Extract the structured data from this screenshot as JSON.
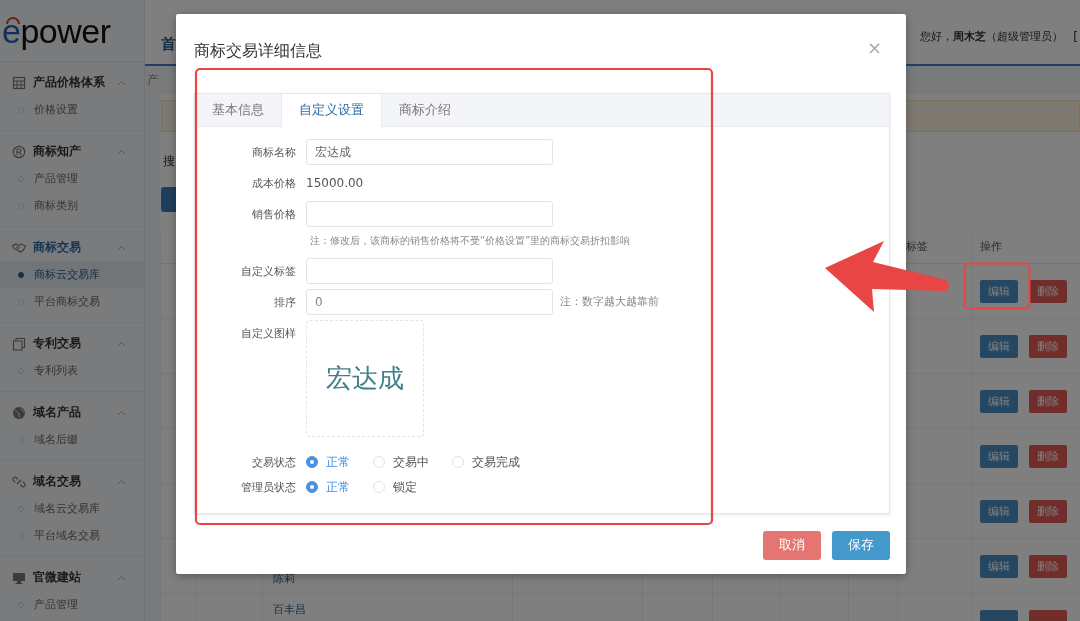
{
  "sidebar": {
    "logo": "epower",
    "groups": [
      {
        "title": "产品价格体系",
        "expanded": true,
        "selected": false,
        "items": [
          {
            "label": "价格设置",
            "selected": false
          }
        ]
      },
      {
        "title": "商标知产",
        "expanded": true,
        "selected": false,
        "items": [
          {
            "label": "产品管理",
            "selected": false
          },
          {
            "label": "商标类别",
            "selected": false
          }
        ]
      },
      {
        "title": "商标交易",
        "expanded": true,
        "selected": true,
        "items": [
          {
            "label": "商标云交易库",
            "selected": true
          },
          {
            "label": "平台商标交易",
            "selected": false
          }
        ]
      },
      {
        "title": "专利交易",
        "expanded": true,
        "selected": false,
        "items": [
          {
            "label": "专利列表",
            "selected": false
          }
        ]
      },
      {
        "title": "域名产品",
        "expanded": true,
        "selected": false,
        "items": [
          {
            "label": "域名后缀",
            "selected": false
          }
        ]
      },
      {
        "title": "域名交易",
        "expanded": true,
        "selected": false,
        "items": [
          {
            "label": "域名云交易库",
            "selected": false
          },
          {
            "label": "平台域名交易",
            "selected": false
          }
        ]
      },
      {
        "title": "官微建站",
        "expanded": true,
        "selected": false,
        "items": [
          {
            "label": "产品管理",
            "selected": false
          }
        ]
      }
    ]
  },
  "header": {
    "tab": "首",
    "greeting": "您好，**周木芝**（超级管理员）",
    "bracket": "["
  },
  "content": {
    "breadcrumb": "产",
    "search_label": "搜",
    "table": {
      "columns": {
        "tags": "标签",
        "actions": "操作"
      },
      "rows": [
        {
          "actions": [
            {
              "kind": "edit",
              "label": "编辑"
            },
            {
              "kind": "delete",
              "label": "删除"
            }
          ]
        },
        {
          "actions": [
            {
              "kind": "edit",
              "label": "编辑"
            },
            {
              "kind": "delete",
              "label": "删除"
            }
          ]
        },
        {
          "actions": [
            {
              "kind": "edit",
              "label": "编辑"
            },
            {
              "kind": "delete",
              "label": "删除"
            }
          ]
        },
        {
          "actions": [
            {
              "kind": "edit",
              "label": "编辑"
            },
            {
              "kind": "delete",
              "label": "删除"
            }
          ]
        },
        {
          "actions": [
            {
              "kind": "edit",
              "label": "编辑"
            },
            {
              "kind": "delete",
              "label": "删除"
            }
          ]
        },
        {
          "owner": "陈莉",
          "actions": [
            {
              "kind": "edit",
              "label": "编辑"
            },
            {
              "kind": "delete",
              "label": "删除"
            }
          ]
        },
        {
          "name": "百丰昌",
          "actions": [
            {
              "kind": "edit"
            },
            {
              "kind": "delete"
            }
          ]
        }
      ]
    }
  },
  "modal": {
    "title": "商标交易详细信息",
    "close": "×",
    "tabs": [
      {
        "label": "基本信息",
        "selected": false
      },
      {
        "label": "自定义设置",
        "selected": true
      },
      {
        "label": "商标介绍",
        "selected": false
      }
    ],
    "fields": [
      {
        "kind": "input",
        "label": "商标名称",
        "value": "宏达成"
      },
      {
        "kind": "text",
        "label": "成本价格",
        "value": "15000.00"
      },
      {
        "kind": "input",
        "label": "销售价格",
        "note": "注：修改后，该商标的销售价格将不受“价格设置”里的商标交易折扣影响"
      },
      {
        "kind": "input",
        "label": "自定义标签"
      },
      {
        "kind": "input",
        "label": "排序",
        "placeholder": "0",
        "side_note": "注：数字越大越靠前"
      },
      {
        "kind": "image",
        "label": "自定义图样",
        "text": "宏达成"
      },
      {
        "kind": "radio",
        "label": "交易状态",
        "options": [
          {
            "label": "正常",
            "selected": true
          },
          {
            "label": "交易中",
            "selected": false
          },
          {
            "label": "交易完成",
            "selected": false
          }
        ]
      },
      {
        "kind": "radio",
        "label": "管理员状态",
        "options": [
          {
            "label": "正常",
            "selected": true
          },
          {
            "label": "锁定",
            "selected": false
          }
        ]
      }
    ],
    "buttons": [
      {
        "kind": "cancel",
        "label": "取消"
      },
      {
        "kind": "save",
        "label": "保存"
      }
    ]
  }
}
